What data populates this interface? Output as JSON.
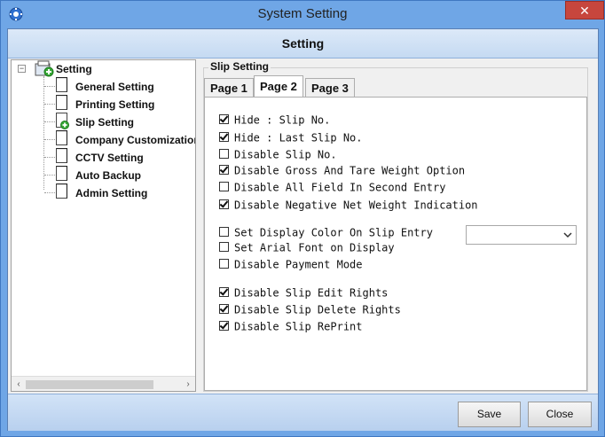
{
  "window": {
    "title": "System Setting",
    "close_glyph": "✕"
  },
  "header": {
    "title": "Setting"
  },
  "tree": {
    "root": "Setting",
    "items": [
      {
        "label": "General Setting"
      },
      {
        "label": "Printing Setting"
      },
      {
        "label": "Slip Setting"
      },
      {
        "label": "Company Customization"
      },
      {
        "label": "CCTV Setting"
      },
      {
        "label": "Auto Backup"
      },
      {
        "label": "Admin Setting"
      }
    ],
    "scroll_left": "‹",
    "scroll_right": "›"
  },
  "group": {
    "title": "Slip Setting"
  },
  "tabs": [
    {
      "label": "Page 1"
    },
    {
      "label": "Page 2"
    },
    {
      "label": "Page 3"
    }
  ],
  "options": [
    {
      "label": "Hide : Slip No.",
      "checked": true
    },
    {
      "label": "Hide : Last Slip No.",
      "checked": true
    },
    {
      "label": "Disable Slip No.",
      "checked": false
    },
    {
      "label": "Disable Gross And Tare Weight Option",
      "checked": true
    },
    {
      "label": "Disable All Field In Second Entry",
      "checked": false
    },
    {
      "label": "Disable Negative Net Weight Indication",
      "checked": true
    },
    {
      "label": "Set Display Color On Slip Entry",
      "checked": false
    },
    {
      "label": "Set Arial Font on Display",
      "checked": false
    },
    {
      "label": "Disable Payment Mode",
      "checked": false
    },
    {
      "label": "Disable Slip Edit Rights",
      "checked": true
    },
    {
      "label": "Disable Slip Delete Rights",
      "checked": true
    },
    {
      "label": "Disable Slip RePrint",
      "checked": true
    }
  ],
  "color_select": {
    "value": ""
  },
  "buttons": {
    "save": "Save",
    "close": "Close"
  }
}
